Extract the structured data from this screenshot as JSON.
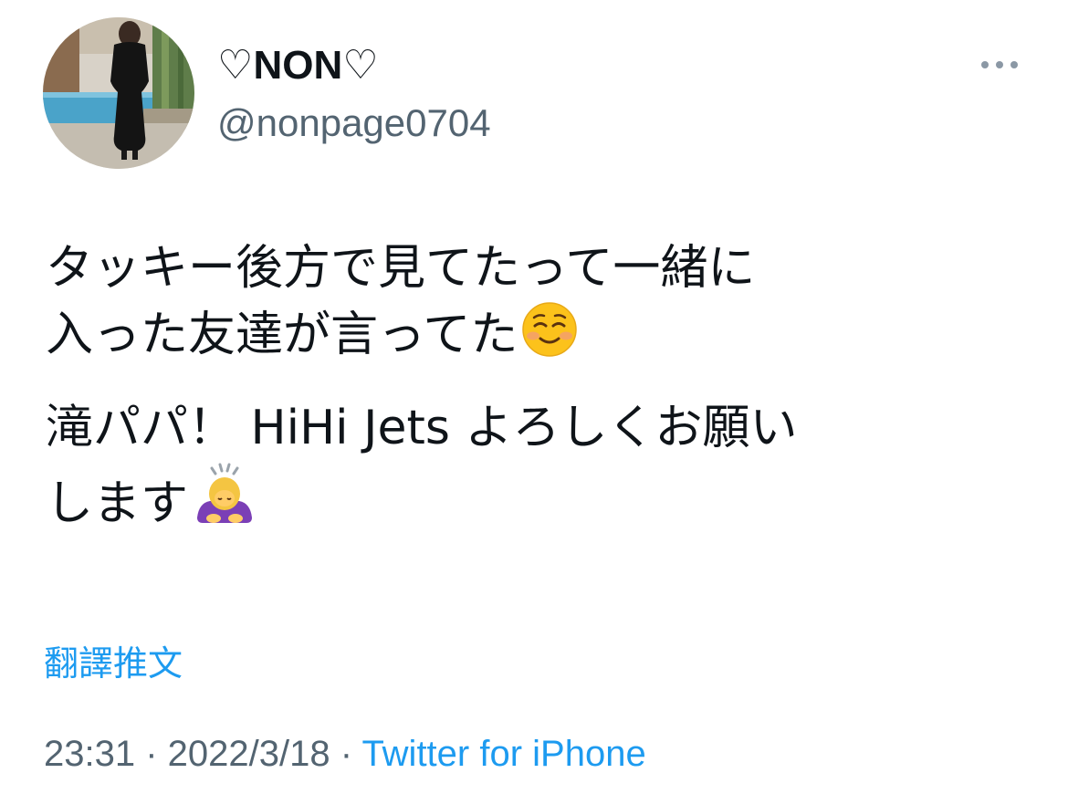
{
  "profile": {
    "display_name": "♡NON♡",
    "handle": "@nonpage0704"
  },
  "icons": {
    "more": "more-horizontal-icon",
    "avatar": "profile-photo"
  },
  "tweet": {
    "paragraph_1": "タッキー後方で見てたって一緒に\n入った友達が言ってた",
    "paragraph_1_emoji": "smiling-face-icon",
    "paragraph_2": "滝パパ！ HiHi Jets よろしくお願い\nします",
    "paragraph_2_emoji": "person-bowing-icon"
  },
  "translate_label": "翻譯推文",
  "meta": {
    "time": "23:31",
    "separator": " · ",
    "date": "2022/3/18",
    "source": "Twitter for iPhone"
  },
  "colors": {
    "link": "#1d9bf0",
    "secondary_text": "#536471",
    "primary_text": "#0f1419"
  }
}
